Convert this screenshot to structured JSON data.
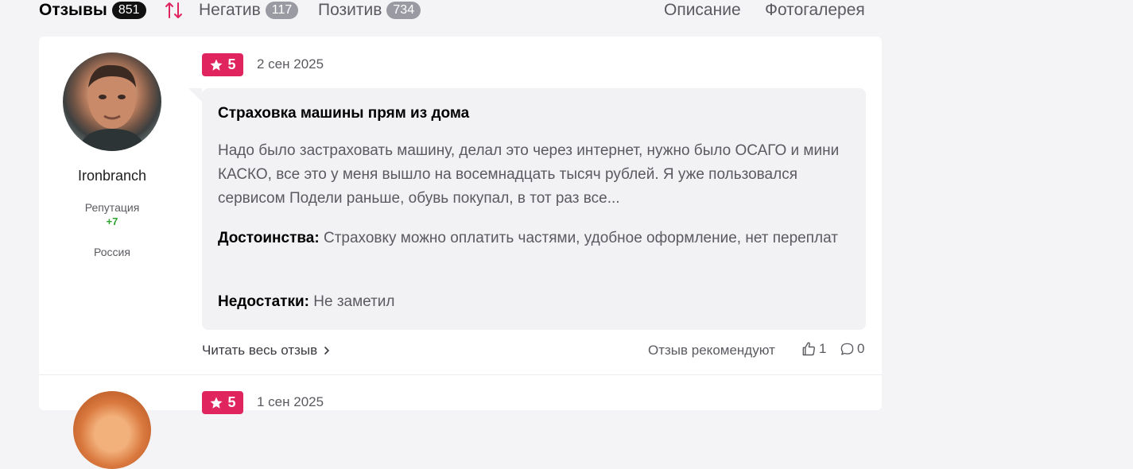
{
  "tabs": {
    "reviews": {
      "label": "Отзывы",
      "count": "851"
    },
    "negative": {
      "label": "Негатив",
      "count": "117"
    },
    "positive": {
      "label": "Позитив",
      "count": "734"
    },
    "description": "Описание",
    "gallery": "Фотогалерея"
  },
  "colors": {
    "accent": "#e0245e",
    "reputation_positive": "#2fa52f"
  },
  "review": {
    "user": {
      "name": "Ironbranch",
      "reputation_label": "Репутация",
      "reputation_value": "+7",
      "country": "Россия"
    },
    "rating": "5",
    "date": "2 сен 2025",
    "title": "Страховка машины прям из дома",
    "text": "Надо было застраховать машину, делал это через интернет, нужно было ОСАГО и мини КАСКО, все это у меня вышло на восемнадцать тысяч рублей. Я уже пользовался сервисом Подели раньше, обувь покупал, в тот раз все...",
    "pros_label": "Достоинства:",
    "pros": "Страховку можно оплатить частями, удобное оформление, нет переплат",
    "cons_label": "Недостатки:",
    "cons": "Не заметил",
    "read_more": "Читать весь отзыв",
    "recommend_label": "Отзыв рекомендуют",
    "likes": "1",
    "comments": "0"
  },
  "next_review": {
    "rating": "5",
    "date": "1 сен 2025"
  },
  "icons": [
    "sort-icon",
    "star-icon",
    "chevron-right-icon",
    "thumbs-up-icon",
    "comment-icon"
  ]
}
